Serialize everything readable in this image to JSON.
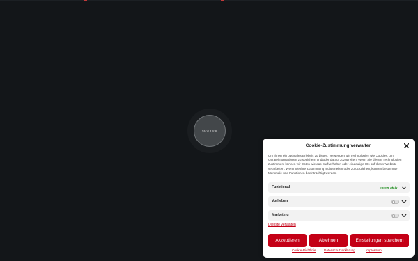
{
  "colors": {
    "page_bg": "#131619",
    "accent": "#c40016",
    "always_active": "#1a8a1a"
  },
  "loader": {
    "logo_text": "MOLLER"
  },
  "consent": {
    "title": "Cookie-Zustimmung verwalten",
    "close_icon": "close-icon",
    "description": "Um Ihnen ein optimales Erlebnis zu bieten, verwenden wir Technologien wie Cookies, um Geräteinformationen zu speichern und/oder darauf zuzugreifen. Wenn Sie diesen Technologien zustimmen, können wir Daten wie das Surfverhalten oder eindeutige IDs auf dieser Website verarbeiten. Wenn Sie Ihre Zustimmung nicht erteilen oder zurückziehen, können bestimmte Merkmale und Funktionen beeinträchtigt werden.",
    "categories": [
      {
        "label": "Funktional",
        "status": "Immer aktiv"
      },
      {
        "label": "Vorlieben",
        "enabled": false
      },
      {
        "label": "Marketing",
        "enabled": false
      }
    ],
    "manage_services": "Dienste verwalten",
    "buttons": {
      "accept": "Akzeptieren",
      "reject": "Ablehnen",
      "settings": "Einstellungen speichern"
    },
    "links": {
      "cookie_policy": "Cookie-Richtlinie",
      "privacy": "Datenschutzerklärung",
      "imprint": "Impressum"
    }
  }
}
